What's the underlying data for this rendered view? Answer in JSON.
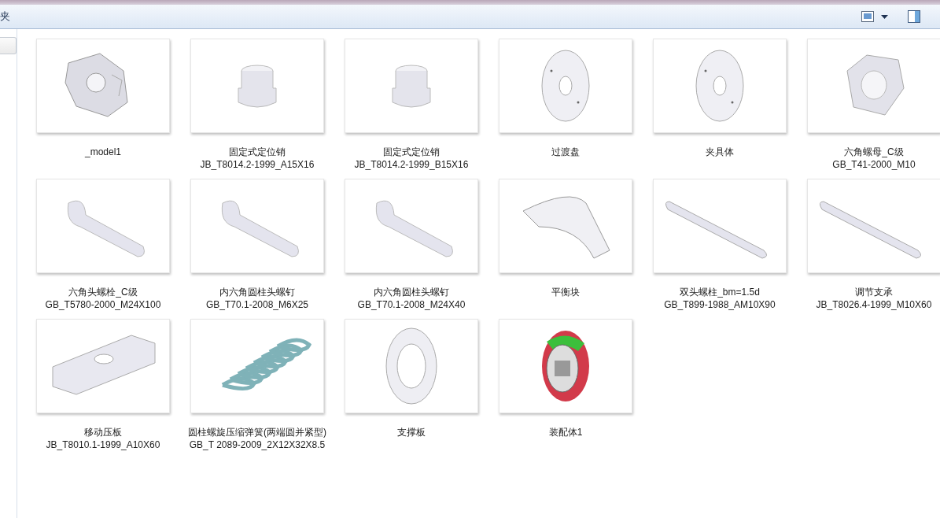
{
  "toolbar": {
    "title": "夹"
  },
  "files": [
    {
      "label_lines": [
        "_model1"
      ],
      "kind": "block"
    },
    {
      "label_lines": [
        "固定式定位销",
        "JB_T8014.2-1999_A15X16"
      ],
      "kind": "pin"
    },
    {
      "label_lines": [
        "固定式定位销",
        "JB_T8014.2-1999_B15X16"
      ],
      "kind": "pin"
    },
    {
      "label_lines": [
        "过渡盘"
      ],
      "kind": "disc"
    },
    {
      "label_lines": [
        "夹具体"
      ],
      "kind": "disc"
    },
    {
      "label_lines": [
        "六角螺母_C级",
        "GB_T41-2000_M10"
      ],
      "kind": "nut"
    },
    {
      "label_lines": [
        "六角头螺栓_C级",
        "GB_T5780-2000_M24X100"
      ],
      "kind": "bolt"
    },
    {
      "label_lines": [
        "内六角圆柱头螺钉",
        "GB_T70.1-2008_M6X25"
      ],
      "kind": "bolt"
    },
    {
      "label_lines": [
        "内六角圆柱头螺钉",
        "GB_T70.1-2008_M24X40"
      ],
      "kind": "bolt"
    },
    {
      "label_lines": [
        "平衡块"
      ],
      "kind": "arc"
    },
    {
      "label_lines": [
        "双头螺柱_bm=1.5d",
        "GB_T899-1988_AM10X90"
      ],
      "kind": "rod"
    },
    {
      "label_lines": [
        "调节支承",
        "JB_T8026.4-1999_M10X60"
      ],
      "kind": "rod"
    },
    {
      "label_lines": [
        "移动压板",
        "JB_T8010.1-1999_A10X60"
      ],
      "kind": "plate"
    },
    {
      "label_lines": [
        "圆柱螺旋压缩弹簧(两端圆并紧型)",
        "GB_T 2089-2009_2X12X32X8.5"
      ],
      "kind": "spring"
    },
    {
      "label_lines": [
        "支撑板"
      ],
      "kind": "ring"
    },
    {
      "label_lines": [
        "装配体1"
      ],
      "kind": "assembly"
    }
  ]
}
